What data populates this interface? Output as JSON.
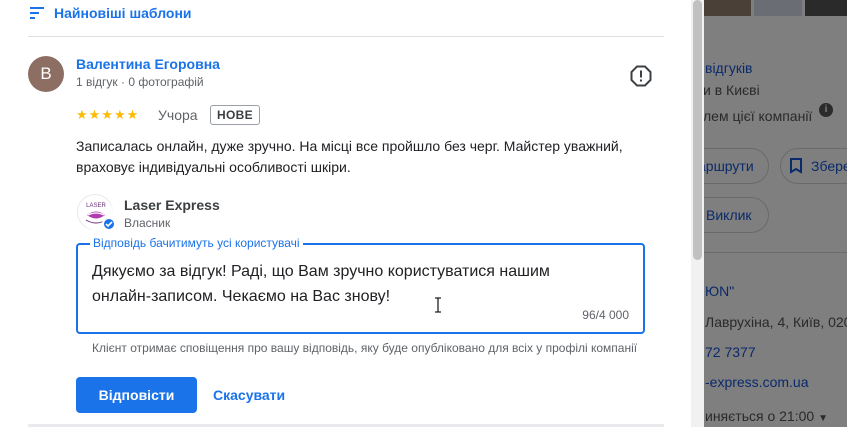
{
  "reviews": {
    "sort_label": "Найновіші шаблони",
    "review": {
      "avatar_letter": "В",
      "author": "Валентина Егоровна",
      "meta": "1 відгук · 0 фотографій",
      "rating": 5,
      "when": "Учора",
      "badge": "НОВЕ",
      "text": "Записалась онлайн, дуже зручно. На місці все пройшло без черг. Майстер уважний, враховує індивідуальні особливості шкіри."
    },
    "owner": {
      "name": "Laser Express",
      "role": "Власник",
      "logo_text": "LASER"
    },
    "reply": {
      "label": "Відповідь бачитимуть усі користувачі",
      "value": "Дякуємо за відгук! Раді, що Вам зручно користуватися нашим онлайн-записом. Чекаємо на Вас знову!",
      "counter": "96/4 000",
      "note": "Клієнт отримає сповіщення про вашу відповідь, яку буде опубліковано для всіх у профілі компанії",
      "submit_label": "Відповісти",
      "cancel_label": "Скасувати"
    }
  },
  "background_panel": {
    "reviews_link": "відгуків",
    "category": "и в Києві",
    "owner_prompt": "лем цієї компанії",
    "routes_button": "аршрути",
    "save_button": "Збере",
    "call_button": "Виклик",
    "name_fragment": "ЮN\"",
    "address": "Лаврухіна, 4, Київ, 020",
    "phone": "72 7377",
    "website": "-express.com.ua",
    "hours": "иняється о 21:00"
  },
  "colors": {
    "accent": "#1a73e8",
    "star": "#fbbc04",
    "avatar_bg": "#8d6e63",
    "overlay": "#7f7f7f"
  }
}
